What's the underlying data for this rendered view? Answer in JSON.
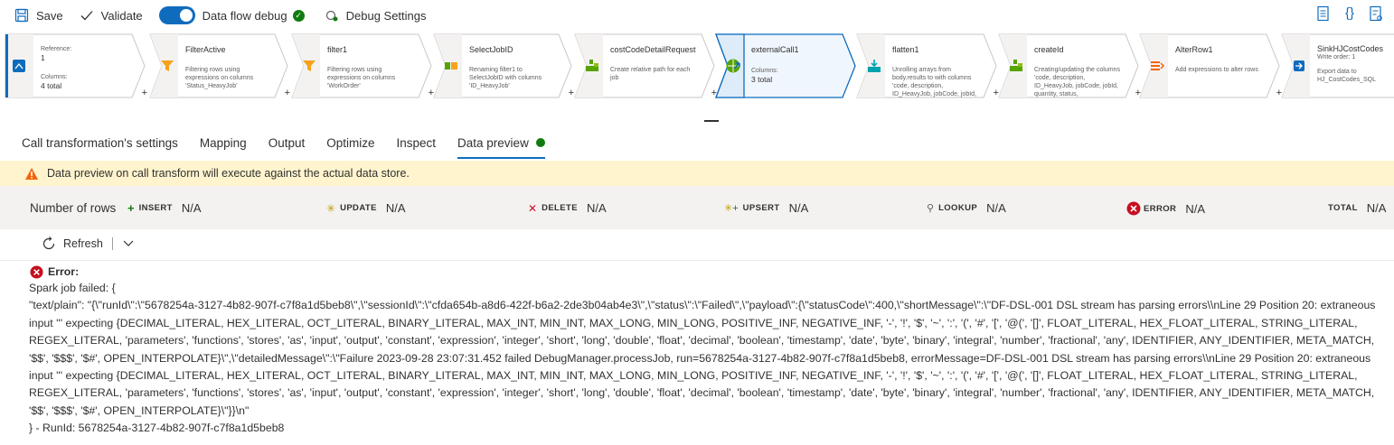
{
  "toolbar": {
    "save_label": "Save",
    "validate_label": "Validate",
    "debug_label": "Data flow debug",
    "debug_settings_label": "Debug Settings"
  },
  "pipeline": {
    "nodes": [
      {
        "name": "Reference:",
        "value": "1",
        "columns_label": "Columns:",
        "columns_value": "4 total",
        "icon": "source-icon"
      },
      {
        "name": "FilterActive",
        "desc": "Filtering rows using expressions on columns 'Status_HeavyJob'",
        "icon": "filter-icon"
      },
      {
        "name": "filter1",
        "desc": "Filtering rows using expressions on columns 'WorkOrder'",
        "icon": "filter-icon"
      },
      {
        "name": "SelectJobID",
        "desc": "Renaming filter1 to SelectJobID with columns 'ID_HeavyJob'",
        "icon": "select-icon"
      },
      {
        "name": "costCodeDetailRequest",
        "desc": "Create relative path for each job",
        "icon": "derived-column-icon"
      },
      {
        "name": "externalCall1",
        "columns_label": "Columns:",
        "columns_value": "3 total",
        "icon": "external-call-icon"
      },
      {
        "name": "flatten1",
        "desc": "Unrolling arrays from body.results to with columns 'code, description, ID_HeavyJob, jobCode, jobId,",
        "icon": "flatten-icon"
      },
      {
        "name": "createId",
        "desc": "Creating/updating the columns 'code, description, ID_HeavyJob, jobCode, jobId, quantity, status,",
        "icon": "derived-column-icon"
      },
      {
        "name": "AlterRow1",
        "desc": "Add expressions to alter rows",
        "icon": "alter-row-icon"
      },
      {
        "name": "SinkHJCostCodes",
        "sub": "Write order: 1",
        "desc": "Export data to HJ_CostCodes_SQL",
        "icon": "sink-icon"
      }
    ]
  },
  "tabs": [
    "Call transformation's settings",
    "Mapping",
    "Output",
    "Optimize",
    "Inspect",
    "Data preview"
  ],
  "warning": "Data preview on call transform will execute against the actual data store.",
  "counts": {
    "rows_label": "Number of rows",
    "insert": {
      "label": "INSERT",
      "value": "N/A"
    },
    "update": {
      "label": "UPDATE",
      "value": "N/A"
    },
    "delete": {
      "label": "DELETE",
      "value": "N/A"
    },
    "upsert": {
      "label": "UPSERT",
      "value": "N/A"
    },
    "lookup": {
      "label": "LOOKUP",
      "value": "N/A"
    },
    "error": {
      "label": "ERROR",
      "value": "N/A"
    },
    "total": {
      "label": "TOTAL",
      "value": "N/A"
    }
  },
  "refresh_label": "Refresh",
  "error": {
    "title": "Error:",
    "body": "Spark job failed: {\n\"text/plain\": \"{\\\"runId\\\":\\\"5678254a-3127-4b82-907f-c7f8a1d5beb8\\\",\\\"sessionId\\\":\\\"cfda654b-a8d6-422f-b6a2-2de3b04ab4e3\\\",\\\"status\\\":\\\"Failed\\\",\\\"payload\\\":{\\\"statusCode\\\":400,\\\"shortMessage\\\":\\\"DF-DSL-001 DSL stream has parsing errors\\\\nLine 29 Position 20: extraneous input ''' expecting {DECIMAL_LITERAL, HEX_LITERAL, OCT_LITERAL, BINARY_LITERAL, MAX_INT, MIN_INT, MAX_LONG, MIN_LONG, POSITIVE_INF, NEGATIVE_INF, '-', '!', '$', '~', ':', '(', '#', '[', '@(', '[]', FLOAT_LITERAL, HEX_FLOAT_LITERAL, STRING_LITERAL, REGEX_LITERAL, 'parameters', 'functions', 'stores', 'as', 'input', 'output', 'constant', 'expression', 'integer', 'short', 'long', 'double', 'float', 'decimal', 'boolean', 'timestamp', 'date', 'byte', 'binary', 'integral', 'number', 'fractional', 'any', IDENTIFIER, ANY_IDENTIFIER, META_MATCH, '$$', '$$$', '$#', OPEN_INTERPOLATE}\\\",\\\"detailedMessage\\\":\\\"Failure 2023-09-28 23:07:31.452 failed DebugManager.processJob, run=5678254a-3127-4b82-907f-c7f8a1d5beb8, errorMessage=DF-DSL-001 DSL stream has parsing errors\\\\nLine 29 Position 20: extraneous input ''' expecting {DECIMAL_LITERAL, HEX_LITERAL, OCT_LITERAL, BINARY_LITERAL, MAX_INT, MIN_INT, MAX_LONG, MIN_LONG, POSITIVE_INF, NEGATIVE_INF, '-', '!', '$', '~', ':', '(', '#', '[', '@(', '[]', FLOAT_LITERAL, HEX_FLOAT_LITERAL, STRING_LITERAL, REGEX_LITERAL, 'parameters', 'functions', 'stores', 'as', 'input', 'output', 'constant', 'expression', 'integer', 'short', 'long', 'double', 'float', 'decimal', 'boolean', 'timestamp', 'date', 'byte', 'binary', 'integral', 'number', 'fractional', 'any', IDENTIFIER, ANY_IDENTIFIER, META_MATCH, '$$', '$$$', '$#', OPEN_INTERPOLATE}\\\"}}\\n\"\n} - RunId: 5678254a-3127-4b82-907f-c7f8a1d5beb8"
  },
  "colors": {
    "accent": "#0f6cbd",
    "success": "#107c10",
    "warning_bg": "#fff4ce",
    "error": "#c50f1f"
  }
}
